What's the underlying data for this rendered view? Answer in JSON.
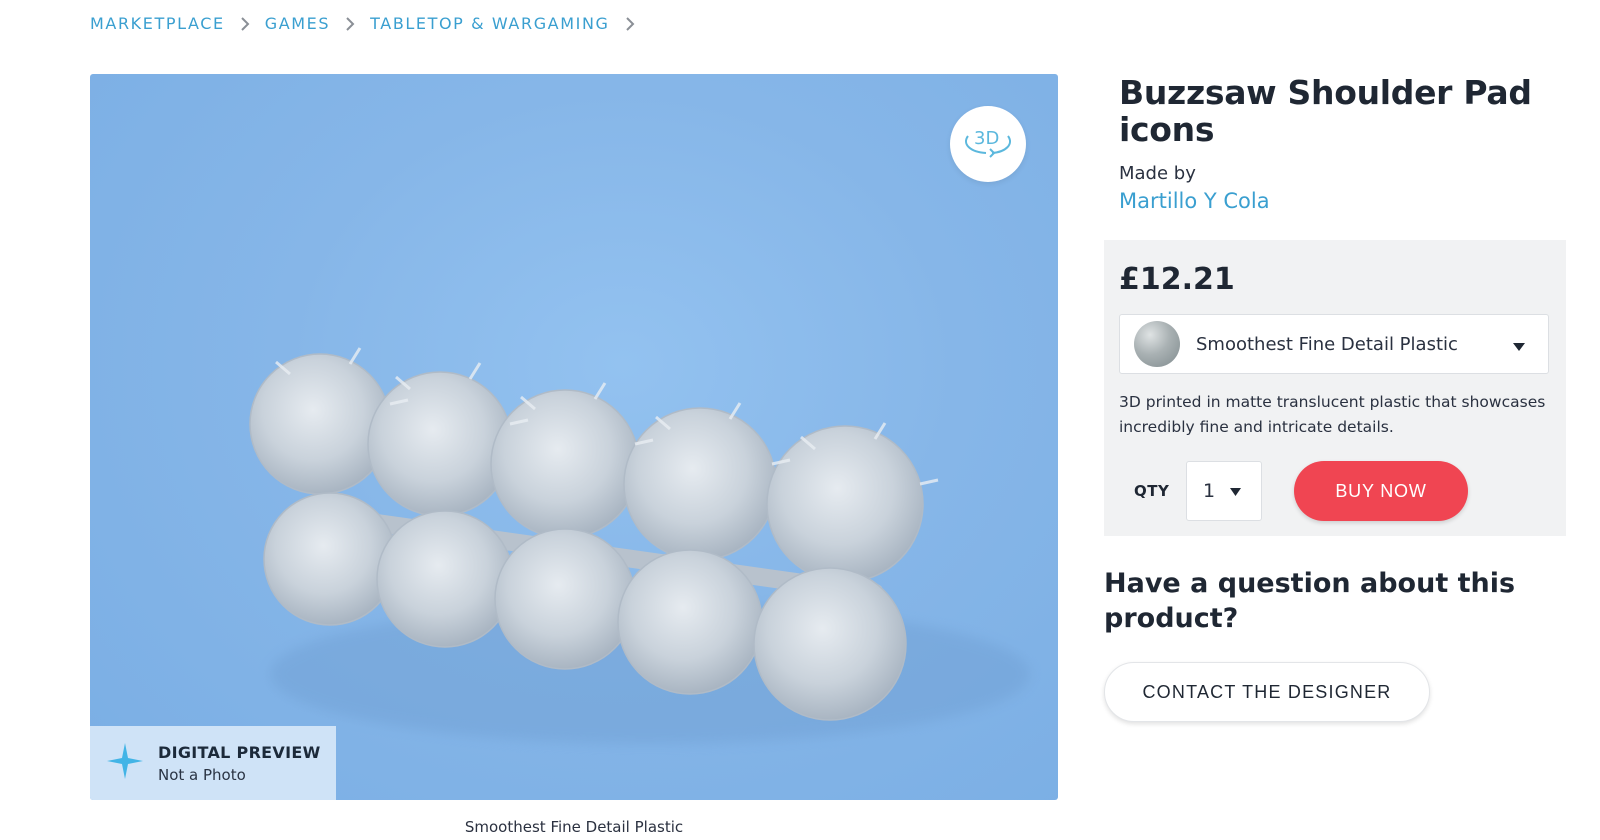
{
  "breadcrumb": {
    "items": [
      {
        "label": "MARKETPLACE"
      },
      {
        "label": "GAMES"
      },
      {
        "label": "TABLETOP & WARGAMING"
      }
    ]
  },
  "preview": {
    "button_3d_icon": "rotate-3d-icon",
    "badge": {
      "icon": "sparkle-icon",
      "title": "DIGITAL PREVIEW",
      "subtitle": "Not a Photo"
    },
    "caption": "Smoothest Fine Detail Plastic"
  },
  "product": {
    "title": "Buzzsaw Shoulder Pad icons",
    "made_by_label": "Made by",
    "designer": "Martillo Y Cola",
    "price": "£12.21",
    "material": {
      "name": "Smoothest Fine Detail Plastic",
      "description": "3D printed in matte translucent plastic that showcases incredibly fine and intricate details."
    },
    "qty_label": "QTY",
    "qty_value": "1",
    "buy_label": "BUY NOW"
  },
  "question": {
    "heading": "Have a question about this product?",
    "contact_label": "CONTACT THE DESIGNER"
  },
  "colors": {
    "accent": "#3a9fd0",
    "buy_button": "#f04552",
    "preview_bg": "#86b6e8",
    "panel_bg": "#f1f2f3"
  }
}
